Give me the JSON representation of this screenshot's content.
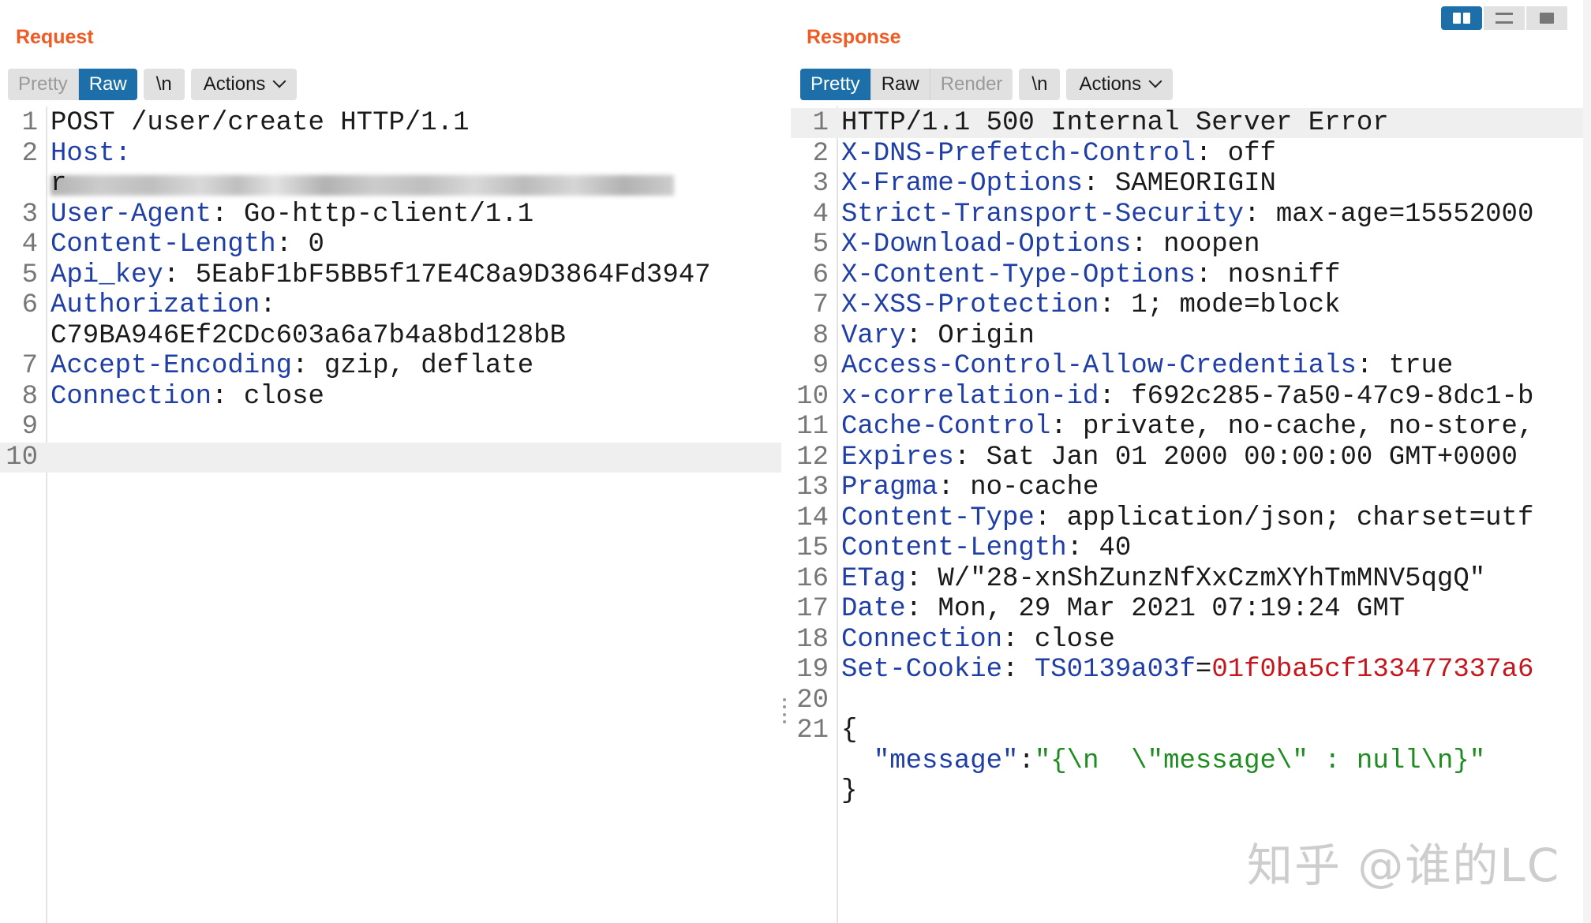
{
  "request": {
    "title": "Request",
    "tabs": [
      {
        "label": "Pretty",
        "state": "disabled"
      },
      {
        "label": "Raw",
        "state": "active"
      }
    ],
    "newline_label": "\\n",
    "actions_label": "Actions",
    "lines": [
      {
        "n": "1",
        "parts": [
          {
            "t": "POST /user/create HTTP/1.1",
            "c": "plain"
          }
        ]
      },
      {
        "n": "2",
        "parts": [
          {
            "t": "Host:",
            "c": "key"
          }
        ]
      },
      {
        "n": "",
        "parts": [
          {
            "t": "r",
            "c": "plain"
          }
        ],
        "blurred": true
      },
      {
        "n": "3",
        "parts": [
          {
            "t": "User-Agent",
            "c": "key"
          },
          {
            "t": ": Go-http-client/1.1",
            "c": "plain"
          }
        ]
      },
      {
        "n": "4",
        "parts": [
          {
            "t": "Content-Length",
            "c": "key"
          },
          {
            "t": ": 0",
            "c": "plain"
          }
        ]
      },
      {
        "n": "5",
        "parts": [
          {
            "t": "Api_key",
            "c": "key"
          },
          {
            "t": ": 5EabF1bF5BB5f17E4C8a9D3864Fd3947",
            "c": "plain"
          }
        ]
      },
      {
        "n": "6",
        "parts": [
          {
            "t": "Authorization",
            "c": "key"
          },
          {
            "t": ":",
            "c": "plain"
          }
        ]
      },
      {
        "n": "",
        "parts": [
          {
            "t": "C79BA946Ef2CDc603a6a7b4a8bd128bB",
            "c": "plain"
          }
        ]
      },
      {
        "n": "7",
        "parts": [
          {
            "t": "Accept-Encoding",
            "c": "key"
          },
          {
            "t": ": gzip, deflate",
            "c": "plain"
          }
        ]
      },
      {
        "n": "8",
        "parts": [
          {
            "t": "Connection",
            "c": "key"
          },
          {
            "t": ": close",
            "c": "plain"
          }
        ]
      },
      {
        "n": "9",
        "parts": []
      },
      {
        "n": "10",
        "parts": [],
        "highlight": true
      }
    ]
  },
  "response": {
    "title": "Response",
    "tabs": [
      {
        "label": "Pretty",
        "state": "active"
      },
      {
        "label": "Raw",
        "state": "normal"
      },
      {
        "label": "Render",
        "state": "disabled"
      }
    ],
    "newline_label": "\\n",
    "actions_label": "Actions",
    "lines": [
      {
        "n": "1",
        "parts": [
          {
            "t": "HTTP/1.1 500 Internal Server Error",
            "c": "plain"
          }
        ],
        "highlight": true
      },
      {
        "n": "2",
        "parts": [
          {
            "t": "X-DNS-Prefetch-Control",
            "c": "key"
          },
          {
            "t": ": off",
            "c": "plain"
          }
        ]
      },
      {
        "n": "3",
        "parts": [
          {
            "t": "X-Frame-Options",
            "c": "key"
          },
          {
            "t": ": SAMEORIGIN",
            "c": "plain"
          }
        ]
      },
      {
        "n": "4",
        "parts": [
          {
            "t": "Strict-Transport-Security",
            "c": "key"
          },
          {
            "t": ": max-age=15552000",
            "c": "plain"
          }
        ]
      },
      {
        "n": "5",
        "parts": [
          {
            "t": "X-Download-Options",
            "c": "key"
          },
          {
            "t": ": noopen",
            "c": "plain"
          }
        ]
      },
      {
        "n": "6",
        "parts": [
          {
            "t": "X-Content-Type-Options",
            "c": "key"
          },
          {
            "t": ": nosniff",
            "c": "plain"
          }
        ]
      },
      {
        "n": "7",
        "parts": [
          {
            "t": "X-XSS-Protection",
            "c": "key"
          },
          {
            "t": ": 1; mode=block",
            "c": "plain"
          }
        ]
      },
      {
        "n": "8",
        "parts": [
          {
            "t": "Vary",
            "c": "key"
          },
          {
            "t": ": Origin",
            "c": "plain"
          }
        ]
      },
      {
        "n": "9",
        "parts": [
          {
            "t": "Access-Control-Allow-Credentials",
            "c": "key"
          },
          {
            "t": ": true",
            "c": "plain"
          }
        ]
      },
      {
        "n": "10",
        "parts": [
          {
            "t": "x-correlation-id",
            "c": "key"
          },
          {
            "t": ": f692c285-7a50-47c9-8dc1-b",
            "c": "plain"
          }
        ]
      },
      {
        "n": "11",
        "parts": [
          {
            "t": "Cache-Control",
            "c": "key"
          },
          {
            "t": ": private, no-cache, no-store,",
            "c": "plain"
          }
        ]
      },
      {
        "n": "12",
        "parts": [
          {
            "t": "Expires",
            "c": "key"
          },
          {
            "t": ": Sat Jan 01 2000 00:00:00 GMT+0000",
            "c": "plain"
          }
        ]
      },
      {
        "n": "13",
        "parts": [
          {
            "t": "Pragma",
            "c": "key"
          },
          {
            "t": ": no-cache",
            "c": "plain"
          }
        ]
      },
      {
        "n": "14",
        "parts": [
          {
            "t": "Content-Type",
            "c": "key"
          },
          {
            "t": ": application/json; charset=utf",
            "c": "plain"
          }
        ]
      },
      {
        "n": "15",
        "parts": [
          {
            "t": "Content-Length",
            "c": "key"
          },
          {
            "t": ": 40",
            "c": "plain"
          }
        ]
      },
      {
        "n": "16",
        "parts": [
          {
            "t": "ETag",
            "c": "key"
          },
          {
            "t": ": W/\"28-xnShZunzNfXxCzmXYhTmMNV5qgQ\"",
            "c": "plain"
          }
        ]
      },
      {
        "n": "17",
        "parts": [
          {
            "t": "Date",
            "c": "key"
          },
          {
            "t": ": Mon, 29 Mar 2021 07:19:24 GMT",
            "c": "plain"
          }
        ]
      },
      {
        "n": "18",
        "parts": [
          {
            "t": "Connection",
            "c": "key"
          },
          {
            "t": ": close",
            "c": "plain"
          }
        ]
      },
      {
        "n": "19",
        "parts": [
          {
            "t": "Set-Cookie",
            "c": "key"
          },
          {
            "t": ": ",
            "c": "plain"
          },
          {
            "t": "TS0139a03f",
            "c": "ckey"
          },
          {
            "t": "=",
            "c": "plain"
          },
          {
            "t": "01f0ba5cf133477337a6",
            "c": "cval"
          }
        ]
      },
      {
        "n": "20",
        "parts": []
      },
      {
        "n": "21",
        "parts": [
          {
            "t": "{",
            "c": "plain"
          }
        ]
      },
      {
        "n": "",
        "parts": [
          {
            "t": "  ",
            "c": "plain"
          },
          {
            "t": "\"message\"",
            "c": "key"
          },
          {
            "t": ":",
            "c": "plain"
          },
          {
            "t": "\"{\\n  \\\"message\\\" : null\\n}\"",
            "c": "str"
          }
        ]
      },
      {
        "n": "",
        "parts": [
          {
            "t": "}",
            "c": "plain"
          }
        ]
      }
    ]
  },
  "watermark": "知乎 @谁的LC",
  "colors": {
    "accent_orange": "#f05a23",
    "active_tab_blue": "#1c6fa8",
    "header_key_blue": "#1f3fa6",
    "cookie_value_red": "#c4161c",
    "json_string_green": "#1e8c1e"
  }
}
